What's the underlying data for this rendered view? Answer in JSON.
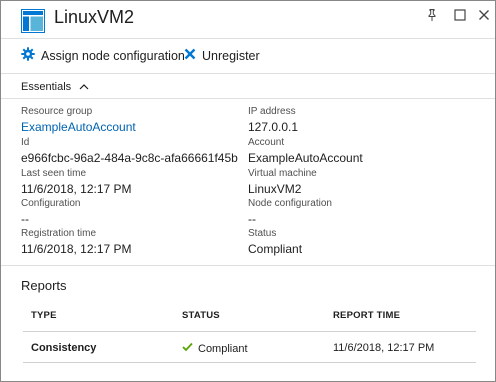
{
  "window": {
    "title": "LinuxVM2"
  },
  "toolbar": {
    "assign_label": "Assign node configuration",
    "unregister_label": "Unregister"
  },
  "essentials": {
    "toggle_label": "Essentials",
    "left": [
      {
        "label": "Resource group",
        "value": "ExampleAutoAccount",
        "is_link": true
      },
      {
        "label": "Id",
        "value": "e966fcbc-96a2-484a-9c8c-afa66661f45b",
        "is_link": false
      },
      {
        "label": "Last seen time",
        "value": "11/6/2018, 12:17 PM",
        "is_link": false
      },
      {
        "label": "Configuration",
        "value": "--",
        "is_link": false
      },
      {
        "label": "Registration time",
        "value": "11/6/2018, 12:17 PM",
        "is_link": false
      }
    ],
    "right": [
      {
        "label": "IP address",
        "value": "127.0.0.1"
      },
      {
        "label": "Account",
        "value": "ExampleAutoAccount"
      },
      {
        "label": "Virtual machine",
        "value": "LinuxVM2"
      },
      {
        "label": "Node configuration",
        "value": "--"
      },
      {
        "label": "Status",
        "value": "Compliant"
      }
    ]
  },
  "reports": {
    "title": "Reports",
    "columns": [
      "TYPE",
      "STATUS",
      "REPORT TIME"
    ],
    "rows": [
      {
        "type": "Consistency",
        "status": "Compliant",
        "report_time": "11/6/2018, 12:17 PM"
      }
    ]
  },
  "colors": {
    "accent": "#0078d4",
    "link": "#0063b1",
    "success": "#57a300"
  }
}
